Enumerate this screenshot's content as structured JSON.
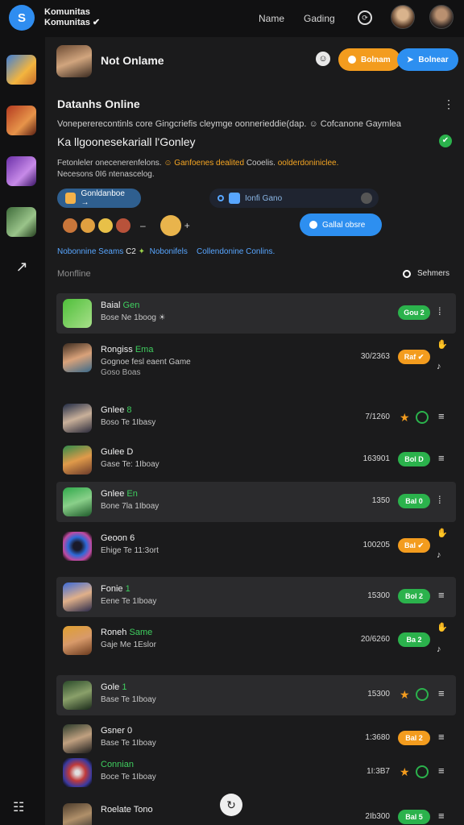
{
  "brand": {
    "line1": "Komunitas",
    "line2": "Komunitas ✔",
    "logo_glyph": "S"
  },
  "nav": {
    "link1": "Name",
    "link2": "Gading",
    "icon": "refresh-icon"
  },
  "profile": {
    "name": "Not Onlame",
    "btn_orange": "Bolnam",
    "btn_blue": "Bolnear"
  },
  "colors": {
    "accent_blue": "#2d8ff0",
    "accent_orange": "#f39c1e",
    "status_green": "#2bb24c"
  },
  "section": {
    "title": "Datanhs Online",
    "desc1": "Vonepererecontinls core Gingcriefis cleymge oonnerieddie(dap. ☺ Cofcanone Gaymlea",
    "big_sub": "Ka llgoonesekariall l'Gonley",
    "desc2_a": "Fetonleler onecenerenfelons.",
    "desc2_hl": "☺ Ganfoenes dealited",
    "desc2_b": "Cooelis.",
    "desc2_hl2": "oolderdoniniclee.",
    "desc2_c": "Necesons 0I6 ntenascelog."
  },
  "chips": {
    "chip1": "Gonldanboe →",
    "chip2": "Ionfi Gano"
  },
  "online_button": "Gallal obsre",
  "links": {
    "a": "Nobonnine Seams",
    "b": "C2",
    "c": "Nobonifels",
    "d": "Collendonine Conlins."
  },
  "list": {
    "label": "Monfline",
    "sort": "Sehmers"
  },
  "rows": [
    {
      "title": "Baial",
      "title_green": "Gen",
      "sub": "Bose Ne 1boog ☀",
      "num": "",
      "badge": "Gou 2"
    },
    {
      "title": "Rongiss",
      "title_green": "Ema",
      "sub": "Gognoe fesl eaent Game",
      "sub2": "Goso Boas",
      "num": "30/2363",
      "badge": "Raf ✔"
    },
    {
      "title": "Gnlee",
      "title_green": "8",
      "sub": "Boso Te 1Ibasy",
      "num": "7/1260",
      "badge": ""
    },
    {
      "title": "Gulee D",
      "title_green": "",
      "sub": "Gase Te: 1Iboay",
      "num": "163901",
      "badge": "Bol D"
    },
    {
      "title": "Gnlee",
      "title_green": "En",
      "sub": "Bone 7la 1Iboay",
      "num": "1350",
      "badge": "Bal 0"
    },
    {
      "title": "Geoon 6",
      "title_green": "",
      "sub": "Ehige Te 11:3ort",
      "num": "100205",
      "badge": "Bal ✔"
    },
    {
      "title": "Fonie",
      "title_green": "1",
      "sub": "Eene Te 1Iboay",
      "num": "15300",
      "badge": "Bol 2"
    },
    {
      "title": "Roneh",
      "title_green": "Same",
      "sub": "Gaje Me 1Eslor",
      "num": "20/6260",
      "badge": "Ba 2"
    },
    {
      "title": "Gole",
      "title_green": "1",
      "sub": "Base Te 1Iboay",
      "num": "15300",
      "badge": ""
    },
    {
      "title": "Gsner 0",
      "title_green": "",
      "sub": "Base Te 1Iboay",
      "num": "1:3680",
      "badge": "Bal 2"
    },
    {
      "title": "",
      "title_green": "Connian",
      "sub": "Boce Te 1Iboay",
      "num": "1I:3B7",
      "badge": ""
    },
    {
      "title": "Roelate Tono",
      "title_green": "",
      "sub": "",
      "num": "2Ib300",
      "badge": "Bal 5"
    }
  ]
}
